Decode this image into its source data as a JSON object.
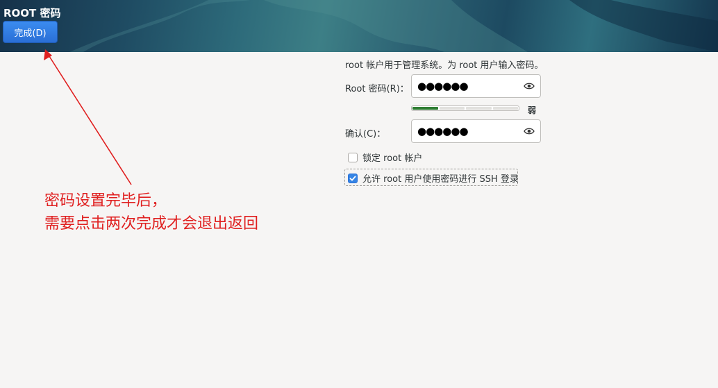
{
  "header": {
    "title": "ROOT 密码",
    "done_label": "完成(D)"
  },
  "form": {
    "description": "root 帐户用于管理系统。为 root 用户输入密码。",
    "password_label": "Root 密码(R)：",
    "password_value": "●●●●●●",
    "strength_fraction": 0.25,
    "strength_text": "弱",
    "confirm_label": "确认(C)：",
    "confirm_value": "●●●●●●",
    "lock_label": "锁定 root 帐户",
    "lock_checked": false,
    "ssh_label": "允许 root 用户使用密码进行 SSH 登录",
    "ssh_checked": true
  },
  "annotation": {
    "line1": "密码设置完毕后，",
    "line2": "需要点击两次完成才会退出返回",
    "color": "#e02020"
  }
}
